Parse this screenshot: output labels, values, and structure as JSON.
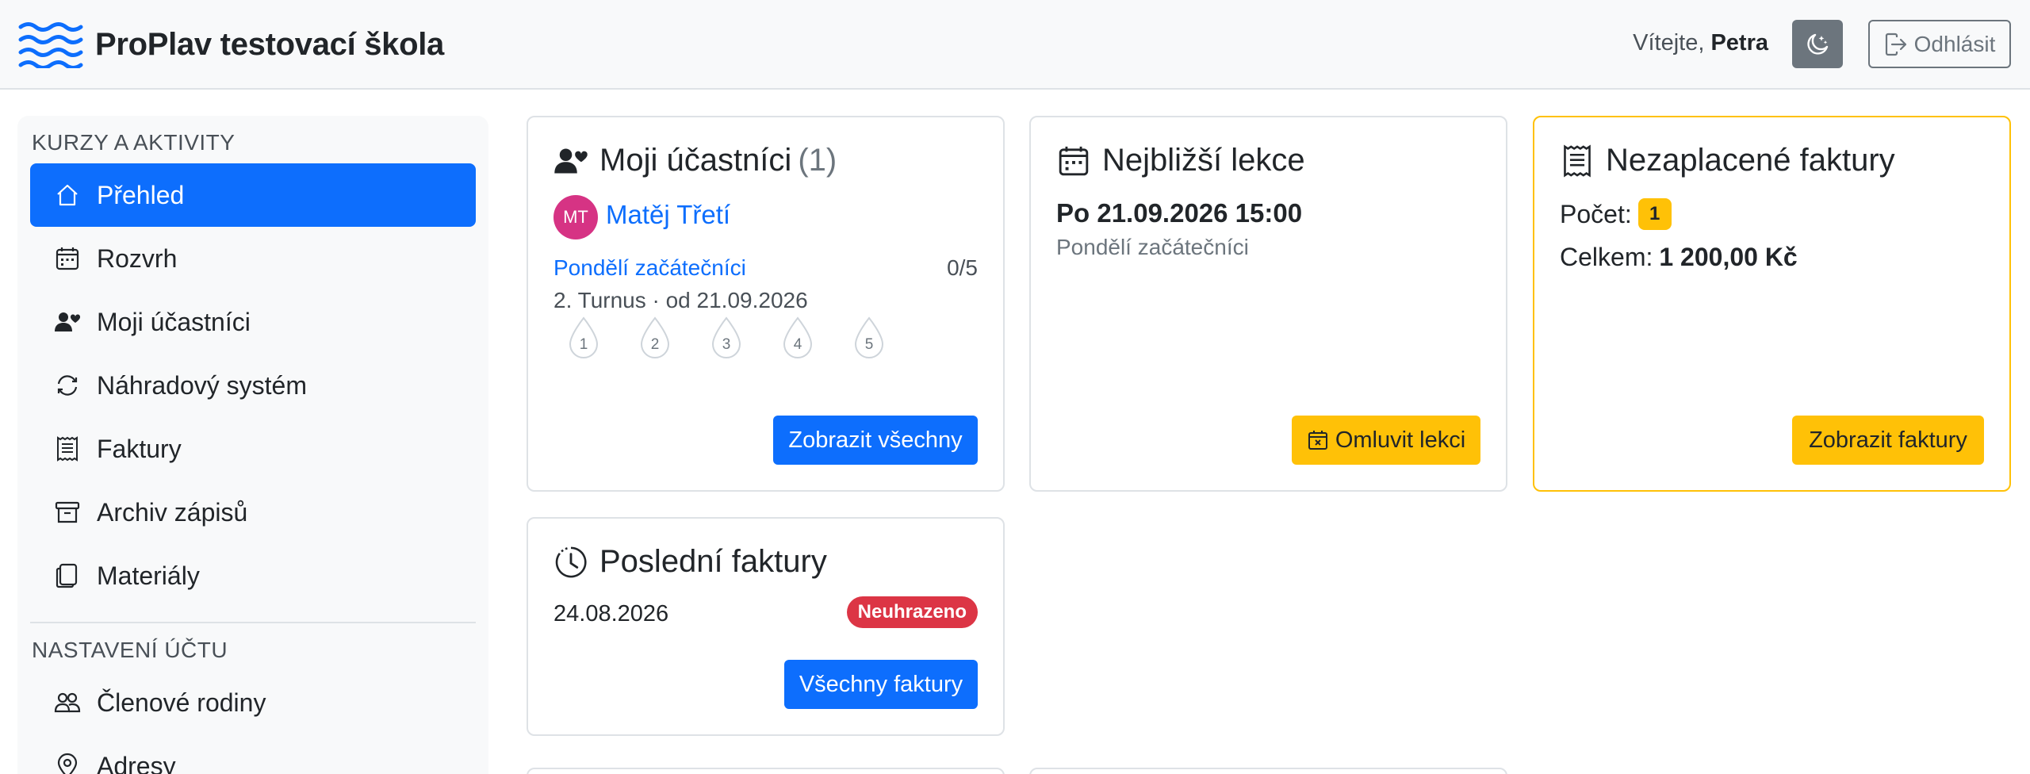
{
  "header": {
    "school_name": "ProPlav testovací škola",
    "welcome_prefix": "Vítejte, ",
    "user_name": "Petra",
    "logout_label": "Odhlásit"
  },
  "sidebar": {
    "section1_heading": "Kurzy a aktivity",
    "items": [
      {
        "label": "Přehled",
        "icon": "house-icon",
        "active": true
      },
      {
        "label": "Rozvrh",
        "icon": "calendar-icon"
      },
      {
        "label": "Moji účastníci",
        "icon": "person-heart-icon"
      },
      {
        "label": "Náhradový systém",
        "icon": "arrow-repeat-icon"
      },
      {
        "label": "Faktury",
        "icon": "receipt-icon"
      },
      {
        "label": "Archiv zápisů",
        "icon": "archive-icon"
      },
      {
        "label": "Materiály",
        "icon": "files-icon"
      }
    ],
    "section2_heading": "Nastavení účtu",
    "items2": [
      {
        "label": "Členové rodiny",
        "icon": "people-icon"
      },
      {
        "label": "Adresy",
        "icon": "geo-icon"
      }
    ]
  },
  "cards": {
    "participants": {
      "title": "Moji účastníci",
      "count": "(1)",
      "participant_initials": "MT",
      "participant_name": "Matěj Třetí",
      "course_name": "Pondělí začátečníci",
      "course_ratio": "0/5",
      "course_meta": "2. Turnus · od 21.09.2026",
      "lesson_drops": [
        "1",
        "2",
        "3",
        "4",
        "5"
      ],
      "button_label": "Zobrazit všechny"
    },
    "next_lesson": {
      "title": "Nejbližší lekce",
      "date": "Po 21.09.2026 15:00",
      "course_name": "Pondělí začátečníci",
      "button_label": "Omluvit lekci"
    },
    "unpaid": {
      "title": "Nezaplacené faktury",
      "count_label": "Počet:",
      "count_value": "1",
      "total_label": "Celkem:",
      "total_value": "1 200,00 Kč",
      "button_label": "Zobrazit faktury"
    },
    "last_invoices": {
      "title": "Poslední faktury",
      "date": "24.08.2026",
      "status": "Neuhrazeno",
      "button_label": "Všechny faktury"
    }
  },
  "colors": {
    "primary": "#0d6efd",
    "warning": "#ffc107",
    "danger": "#dc3545",
    "avatar": "#d63384"
  }
}
